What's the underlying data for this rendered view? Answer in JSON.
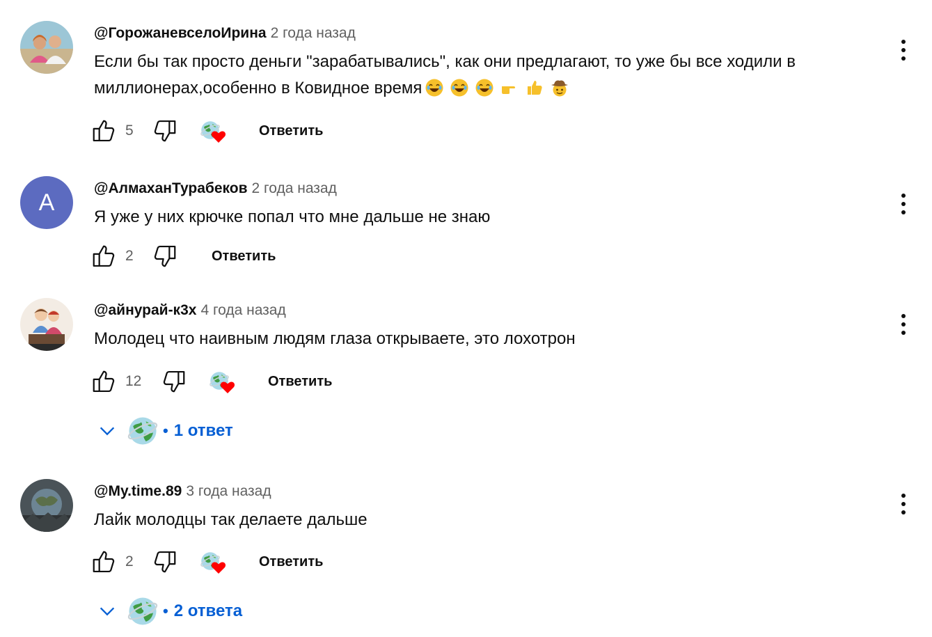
{
  "comments": [
    {
      "author": "@ГорожаневселоИрина",
      "time": "2 года назад",
      "text": "Если бы так просто деньги  \"зарабатывались\", как они предлагают, то уже бы все ходили в миллионерах,особенно в Ковидное время",
      "emojis": [
        "laughing-emoji",
        "laughing-emoji",
        "laughing-emoji",
        "pointing-right-emoji",
        "thumbs-up-emoji",
        "cowboy-emoji"
      ],
      "likes": "5",
      "reply_label": "Ответить",
      "hearted": true
    },
    {
      "author": "@АлмаханТурабеков",
      "time": "2 года назад",
      "text": "Я уже у них крючке попал что мне дальше не знаю",
      "avatar_letter": "A",
      "likes": "2",
      "reply_label": "Ответить",
      "hearted": false
    },
    {
      "author": "@айнурай-к3х",
      "time": "4 года назад",
      "text": "Молодец что наивным людям глаза открываете, это лохотрон",
      "likes": "12",
      "reply_label": "Ответить",
      "hearted": true,
      "replies_label": "1 ответ"
    },
    {
      "author": "@My.time.89",
      "time": "3 года назад",
      "text": "Лайк молодцы так делаете дальше",
      "likes": "2",
      "reply_label": "Ответить",
      "hearted": true,
      "replies_label": "2 ответа"
    }
  ],
  "colors": {
    "link_blue": "#065fd4",
    "heart_red": "#ff0000",
    "avatar_letter_bg": "#5c6bc0",
    "meta_gray": "#606060"
  }
}
